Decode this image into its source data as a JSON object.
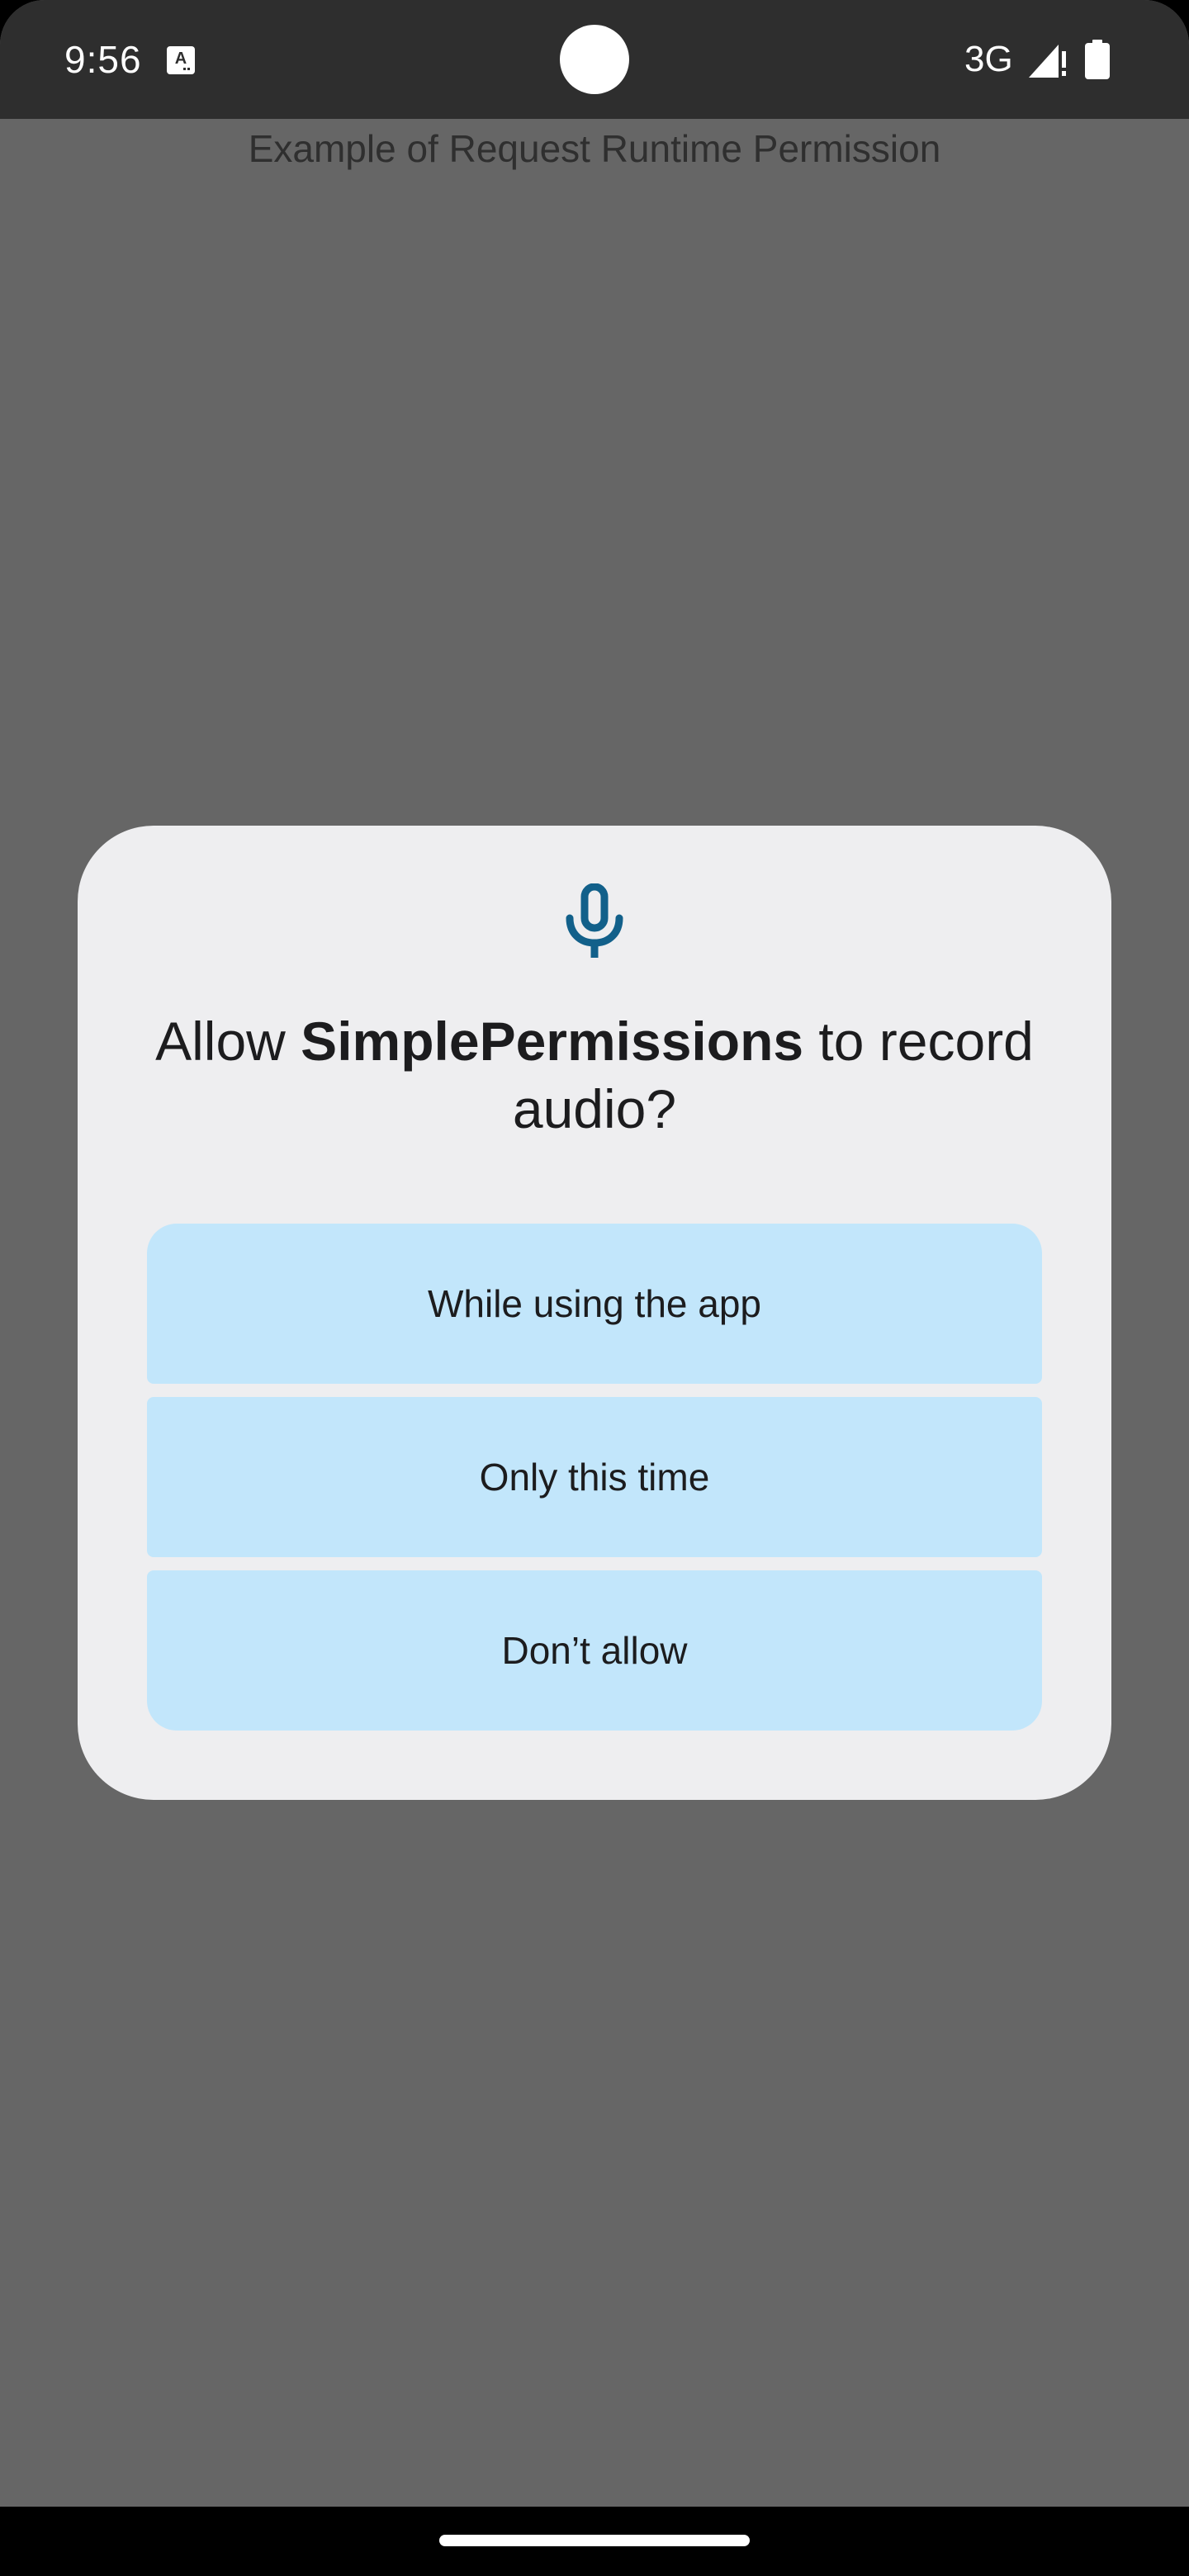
{
  "status_bar": {
    "time": "9:56",
    "network": "3G",
    "notification_icon": "text-a-icon",
    "signal_icon": "signal-icon",
    "battery_icon": "battery-icon"
  },
  "app": {
    "title": "Example of Request Runtime Permission"
  },
  "dialog": {
    "icon": "microphone-icon",
    "title_prefix": "Allow ",
    "app_name": "SimplePermissions",
    "title_suffix": " to record audio?",
    "options": [
      {
        "label": "While using the app"
      },
      {
        "label": "Only this time"
      },
      {
        "label": "Don’t allow"
      }
    ]
  },
  "colors": {
    "status_bar": "#2e2e2e",
    "scrim_background": "#666666",
    "dialog_background": "#eeeef0",
    "button_background": "#c2e6fb",
    "icon_accent": "#12608a"
  }
}
